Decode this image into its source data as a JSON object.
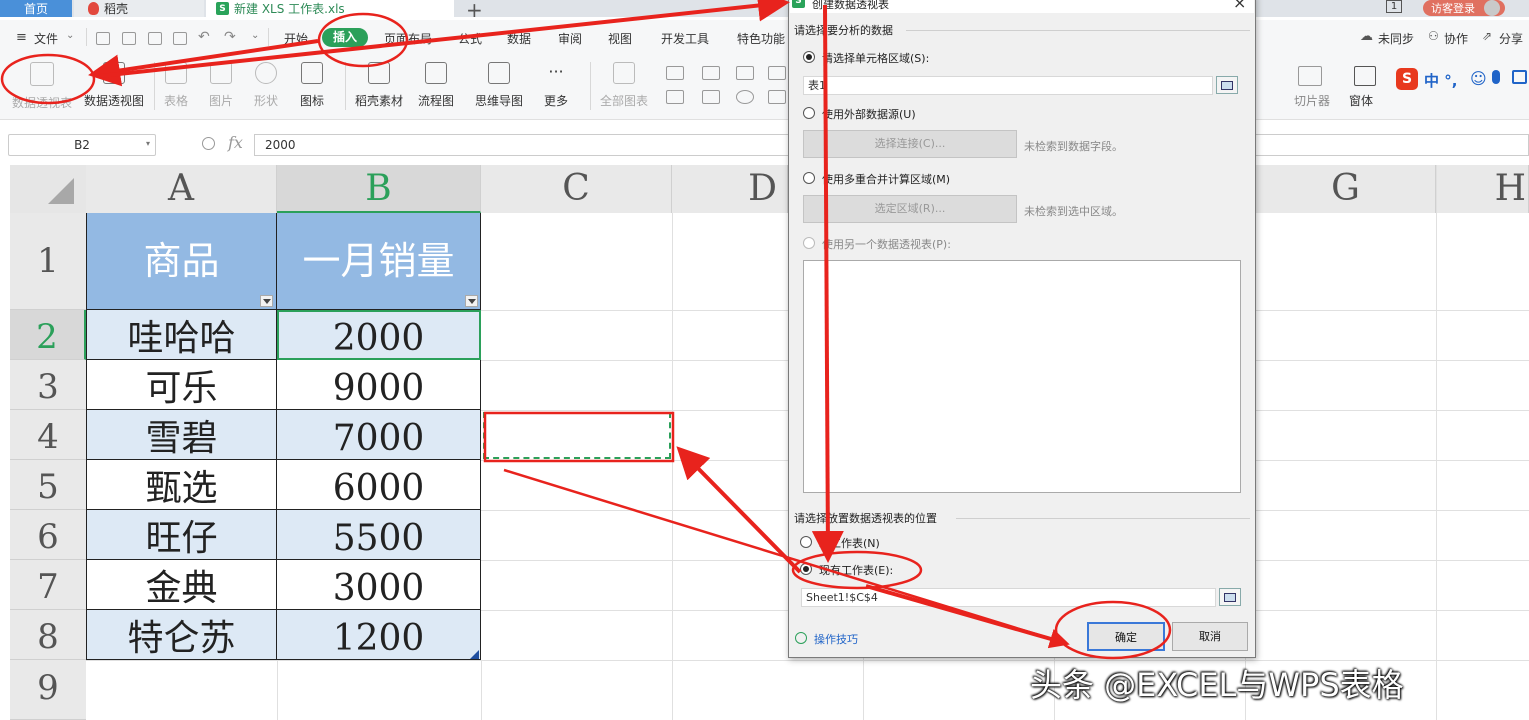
{
  "tabs": {
    "home": "首页",
    "daoke": "稻壳",
    "file": "新建 XLS 工作表.xls",
    "plus": "+",
    "badge": "1",
    "login": "访客登录"
  },
  "menu": {
    "file": "文件",
    "items": [
      "开始",
      "插入",
      "页面布局",
      "公式",
      "数据",
      "审阅",
      "视图",
      "开发工具",
      "特色功能"
    ],
    "right": [
      "未同步",
      "协作",
      "分享"
    ]
  },
  "ribbon": {
    "items": [
      "数据透视表",
      "数据透视图",
      "表格",
      "图片",
      "形状",
      "图标",
      "稻壳素材",
      "流程图",
      "思维导图",
      "更多",
      "全部图表"
    ],
    "right": [
      "切片器",
      "窗体"
    ],
    "ime": "中 °,"
  },
  "formula_bar": {
    "name_box": "B2",
    "fx": "fx",
    "value": "2000"
  },
  "grid": {
    "columns": [
      "A",
      "B",
      "C",
      "D",
      "G",
      "H"
    ],
    "rows": [
      "1",
      "2",
      "3",
      "4",
      "5",
      "6",
      "7",
      "8",
      "9"
    ],
    "header": [
      "商品",
      "一月销量"
    ],
    "data": [
      [
        "哇哈哈",
        "2000"
      ],
      [
        "可乐",
        "9000"
      ],
      [
        "雪碧",
        "7000"
      ],
      [
        "甄选",
        "6000"
      ],
      [
        "旺仔",
        "5500"
      ],
      [
        "金典",
        "3000"
      ],
      [
        "特仑苏",
        "1200"
      ]
    ]
  },
  "dialog": {
    "title": "创建数据透视表",
    "section1": "请选择要分析的数据",
    "opt_select_range": "请选择单元格区域(S):",
    "range_value": "表1",
    "opt_external": "使用外部数据源(U)",
    "btn_connect": "选择连接(C)...",
    "no_fields": "未检索到数据字段。",
    "opt_consolidate": "使用多重合并计算区域(M)",
    "btn_select_region": "选定区域(R)...",
    "no_region": "未检索到选中区域。",
    "opt_another_pivot": "使用另一个数据透视表(P):",
    "section2": "请选择放置数据透视表的位置",
    "opt_new_sheet": "新工作表(N)",
    "opt_existing_sheet": "现有工作表(E):",
    "location_value": "Sheet1!$C$4",
    "tips": "操作技巧",
    "ok": "确定",
    "cancel": "取消"
  },
  "watermark": "头条 @EXCEL与WPS表格",
  "colors": {
    "header_fill": "#93b9e3",
    "banded_fill": "#dde9f5",
    "wps_green": "#2ba05a",
    "annotation_red": "#e8231d"
  }
}
